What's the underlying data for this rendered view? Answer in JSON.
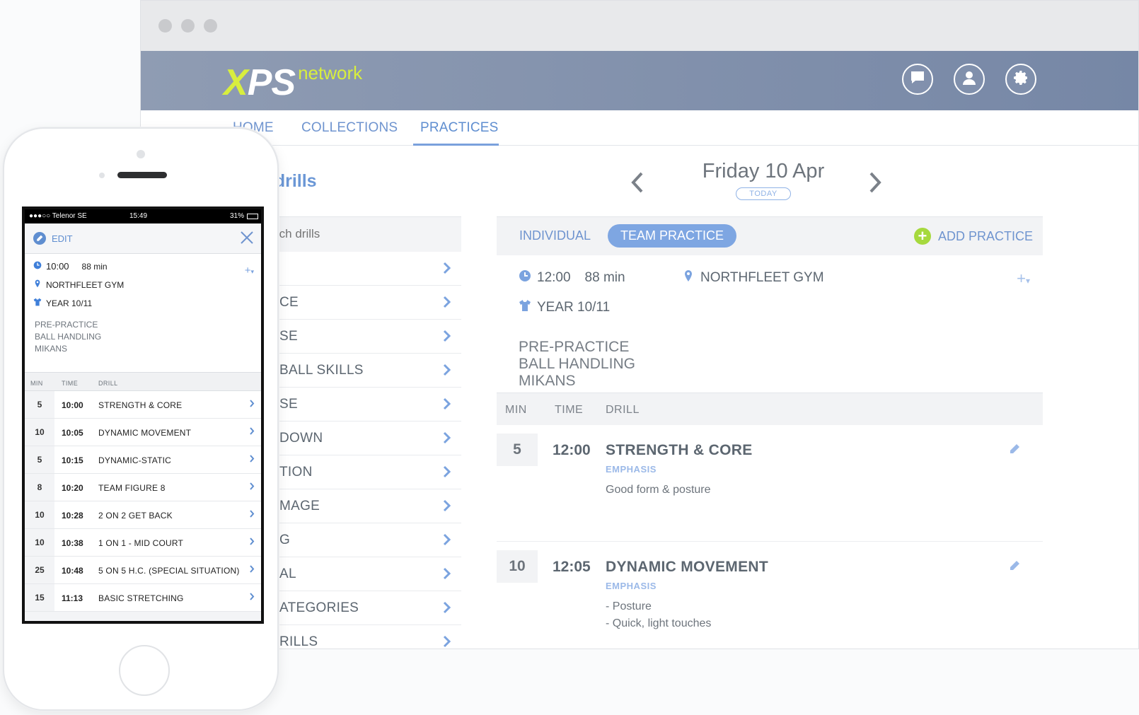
{
  "browser": {
    "logo": {
      "xps": "XPS",
      "network": "network"
    },
    "header_icons": [
      "chat-icon",
      "user-icon",
      "gear-icon"
    ],
    "nav": {
      "home": "HOME",
      "collections": "COLLECTIONS",
      "practices": "PRACTICES"
    }
  },
  "drills": {
    "title": "e drills",
    "search_placeholder": "rch drills",
    "items": [
      "",
      "CE",
      "SE",
      "BALL SKILLS",
      "SE",
      "DOWN",
      "TION",
      "MAGE",
      "G",
      "AL",
      "ATEGORIES",
      "RILLS"
    ]
  },
  "schedule": {
    "date": "Friday 10 Apr",
    "today": "TODAY",
    "tabs": {
      "individual": "INDIVIDUAL",
      "team": "TEAM PRACTICE"
    },
    "add_practice": "ADD PRACTICE",
    "practice": {
      "time": "12:00",
      "duration": "88 min",
      "location": "NORTHFLEET GYM",
      "team": "YEAR 10/11",
      "notes": [
        "PRE-PRACTICE",
        "BALL HANDLING",
        "MIKANS"
      ]
    },
    "columns": {
      "min": "MIN",
      "time": "TIME",
      "drill": "DRILL"
    },
    "rows": [
      {
        "min": "5",
        "time": "12:00",
        "drill": "STRENGTH & CORE",
        "emphasis": "EMPHASIS",
        "desc": [
          "Good form & posture"
        ]
      },
      {
        "min": "10",
        "time": "12:05",
        "drill": "DYNAMIC MOVEMENT",
        "emphasis": "EMPHASIS",
        "desc": [
          "- Posture",
          "- Quick, light touches"
        ]
      }
    ]
  },
  "phone": {
    "status": {
      "carrier": "●●●○○ Telenor SE",
      "time": "15:49",
      "battery": "31%"
    },
    "edit": "EDIT",
    "practice": {
      "time": "10:00",
      "duration": "88 min",
      "location": "NORTHFLEET GYM",
      "team": "YEAR 10/11",
      "notes": [
        "PRE-PRACTICE",
        "BALL HANDLING",
        "MIKANS"
      ]
    },
    "columns": {
      "min": "MIN",
      "time": "TIME",
      "drill": "DRILL"
    },
    "rows": [
      {
        "min": "5",
        "time": "10:00",
        "drill": "STRENGTH & CORE"
      },
      {
        "min": "10",
        "time": "10:05",
        "drill": "DYNAMIC MOVEMENT"
      },
      {
        "min": "5",
        "time": "10:15",
        "drill": "DYNAMIC-STATIC"
      },
      {
        "min": "8",
        "time": "10:20",
        "drill": "TEAM FIGURE 8"
      },
      {
        "min": "10",
        "time": "10:28",
        "drill": "2 ON 2 GET BACK"
      },
      {
        "min": "10",
        "time": "10:38",
        "drill": "1 ON 1 - MID COURT"
      },
      {
        "min": "25",
        "time": "10:48",
        "drill": "5 ON 5 H.C. (SPECIAL SITUATION)"
      },
      {
        "min": "15",
        "time": "11:13",
        "drill": "BASIC STRETCHING"
      }
    ]
  },
  "colors": {
    "accent": "#6f94cf",
    "header": "#7a8aa8",
    "logo_green": "#d8ee3e",
    "add_green": "#a6d93e"
  }
}
